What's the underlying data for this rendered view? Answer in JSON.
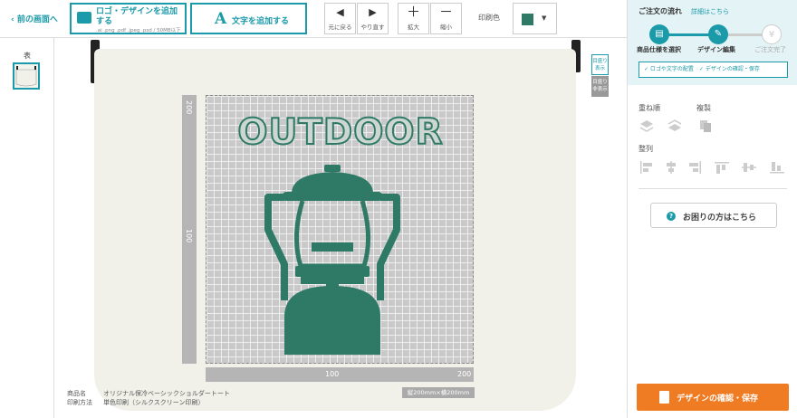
{
  "toolbar": {
    "back_label": "前の画面へ",
    "add_logo_label": "ロゴ・デザインを追加する",
    "add_logo_sub": ".ai .png .pdf .jpeg .psd / 50MB以下",
    "add_text_label": "文字を追加する",
    "undo_label": "元に戻る",
    "redo_label": "やり直す",
    "zoom_in_label": "拡大",
    "zoom_out_label": "縮小",
    "print_color_label": "印刷色",
    "print_color_value": "#2e7a66"
  },
  "left_panel": {
    "side_label": "表"
  },
  "canvas": {
    "design_text": "OUTDOOR",
    "ruler_v": [
      "200",
      "100"
    ],
    "ruler_h": [
      "100",
      "200"
    ],
    "grid_show": "目盛り表示",
    "grid_hide": "目盛り非表示",
    "size_badge": "縦200mm×横200mm",
    "design_color": "#2e7a66"
  },
  "product_info": {
    "name_label": "商品名",
    "name_value": "オリジナル保冷ベーシックショルダートート",
    "method_label": "印刷方法",
    "method_value": "単色印刷（シルクスクリーン印刷）"
  },
  "sidebar": {
    "flow_title": "ご注文の流れ",
    "flow_link": "詳細はこちら",
    "steps": [
      "商品仕様を選択",
      "デザイン編集",
      "ご注文完了"
    ],
    "checklist": "✓ ロゴや文字の配置　✓ デザインの確認・保存",
    "order_label": "重ね順",
    "duplicate_label": "複製",
    "align_label": "整列",
    "help_label": "お困りの方はこちら",
    "confirm_label": "デザインの確認・保存"
  },
  "colors": {
    "accent": "#1b9aa9",
    "design": "#2e7a66",
    "confirm": "#ef7b22"
  }
}
